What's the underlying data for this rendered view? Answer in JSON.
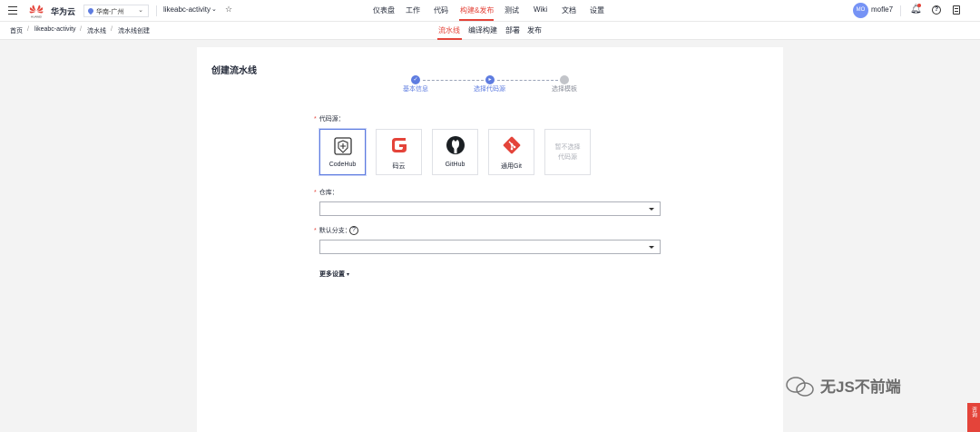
{
  "header": {
    "brand": "华为云",
    "logo_text": "HUAWEI",
    "region": "华南-广州",
    "project": "likeabc-activity",
    "nav": [
      "仪表盘",
      "工作",
      "代码",
      "构建&发布",
      "测试",
      "Wiki",
      "文档",
      "设置"
    ],
    "active_nav": "构建&发布",
    "avatar_initials": "MO",
    "username": "mofle7"
  },
  "breadcrumb": [
    "首页",
    "likeabc-activity",
    "流水线",
    "流水线创建"
  ],
  "subnav": [
    "流水线",
    "编译构建",
    "部署",
    "发布"
  ],
  "page": {
    "title": "创建流水线",
    "steps": [
      {
        "label": "基本信息",
        "state": "done"
      },
      {
        "label": "选择代码源",
        "state": "active"
      },
      {
        "label": "选择模板",
        "state": "pending"
      }
    ],
    "code_source_label": "代码源：",
    "sources": [
      {
        "label": "CodeHub",
        "icon": "codehub-icon",
        "selected": true
      },
      {
        "label": "码云",
        "icon": "gitee-icon",
        "selected": false
      },
      {
        "label": "GitHub",
        "icon": "github-icon",
        "selected": false
      },
      {
        "label": "通用Git",
        "icon": "git-icon",
        "selected": false
      }
    ],
    "no_source_label": "暂不选择代码源",
    "repo_label": "仓库：",
    "repo_value": "",
    "branch_label": "默认分支：",
    "branch_value": "",
    "more_settings": "更多设置"
  },
  "watermark": "无JS不前端",
  "feedback_label": "咨询",
  "colors": {
    "accent_red": "#e4443a",
    "accent_blue": "#5e7ce0"
  }
}
